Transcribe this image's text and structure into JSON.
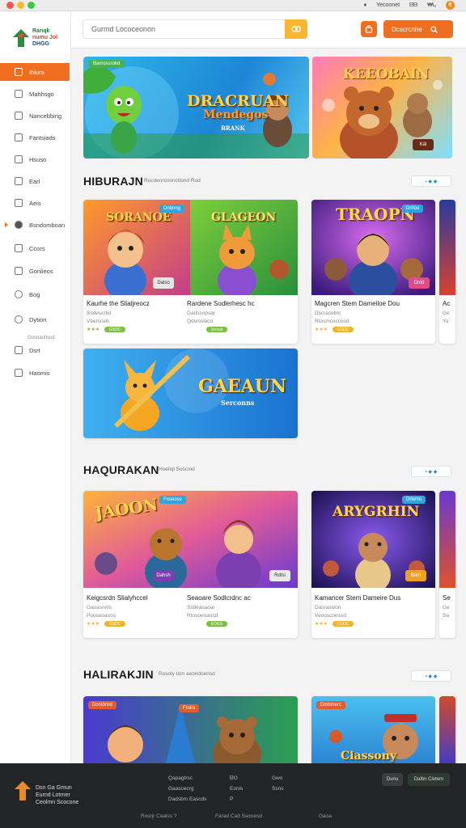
{
  "titlebar": {
    "items": [
      "Yecoonet",
      "ᗷᗷ",
      "₩iₒ"
    ],
    "badge": "₴"
  },
  "header": {
    "search_placeholder": "Gurmd Lococeonon",
    "login_label": "Dcscrcnhe"
  },
  "sidebar": {
    "logo": {
      "line1": "Ranqk",
      "line2": "numu Jol",
      "line3": "DHGG"
    },
    "items": [
      {
        "label": "Ihiura",
        "icon": "home-icon",
        "active": true
      },
      {
        "label": "Mahhsgo",
        "icon": "star-icon"
      },
      {
        "label": "Nancebbing",
        "icon": "gift-icon"
      },
      {
        "label": "Fantsiads",
        "icon": "grid-icon"
      },
      {
        "label": "Hsuso",
        "icon": "house-icon"
      },
      {
        "label": "Earl",
        "icon": "card-icon"
      },
      {
        "label": "Aeis",
        "icon": "tag-icon"
      },
      {
        "label": "Bsndomboan",
        "icon": "user-icon"
      },
      {
        "label": "Ccors",
        "icon": "coin-icon"
      },
      {
        "label": "Gonlieos",
        "icon": "chart-icon"
      },
      {
        "label": "Bog",
        "icon": "search-icon"
      },
      {
        "label": "Dytion",
        "icon": "gear-icon"
      },
      {
        "label": "Dsrt",
        "icon": "calendar-icon"
      },
      {
        "label": "Haomis",
        "icon": "book-icon"
      }
    ],
    "sub_label": "Gosoaotivud"
  },
  "banners": [
    {
      "tag": "Bamossrokd",
      "title_line1": "DRACRUAN",
      "title_line2": "Mendegos",
      "title_line3": "BRANK"
    },
    {
      "title": "KEEOBAIN",
      "button": "Kǎl"
    }
  ],
  "sections": [
    {
      "title": "HIBURAJN",
      "subtitle": "Rucdenrcoonctiond Rod",
      "button": "▪  ◆  ◆",
      "cards": [
        {
          "title": "Kaurhe the Slialjreocz",
          "meta1": "Ssdescrtid",
          "meta2": "Vbersceb.",
          "image_title": "SORANOE",
          "chip": "Dnbnng",
          "btn": "Dalso",
          "stars": "★★★",
          "pill": "GSDC"
        },
        {
          "title": "Rardene Sodlerhesc hc",
          "meta1": "Gadssopsar",
          "meta2": "Qoolsslaco",
          "image_title": "GLAGEON",
          "chip": "",
          "btn": "",
          "stars": "",
          "pill": "1rlosal"
        },
        {
          "title": "Magcren Stem Dameiloe Dou",
          "meta1": "Dscraseblc",
          "meta2": "Rtosmcoccesd",
          "image_title": "TRAOPN",
          "chip": "Drrloo",
          "btn": "Dnld",
          "stars": "★★★",
          "pill": "CGDC"
        },
        {
          "title": "Ac",
          "meta1": "Ge",
          "meta2": "Yo"
        },
        {
          "image_title": "GAEAUN",
          "image_sub": "Serconns"
        }
      ]
    },
    {
      "title": "HAQURAKAN",
      "subtitle": "Hoeliql Soscind",
      "button": "▪  ◆  ◆",
      "cards": [
        {
          "title": "Keigcsrdn Slialyhccel",
          "meta1": "Gaoasnnls",
          "meta2": "Pooseoaoos",
          "image_title": "JAOON",
          "chip": "Foseoss",
          "btn": "Dahsh",
          "stars": "★★★",
          "pill": "GSDC"
        },
        {
          "title": "Seaoare Sodlcrdnc ac",
          "meta1": "Ssdeasaoar",
          "meta2": "Rtosoeoaocd",
          "image_title": "",
          "chip": "",
          "btn": "Rdtsi",
          "stars": "",
          "pill": "EDGS"
        },
        {
          "title": "Kamancer Stem Dameire Dus",
          "meta1": "Dasrassion",
          "meta2": "Veooscoesod",
          "image_title": "ARYGRHIN",
          "chip": "Drlemo",
          "btn": "Bant",
          "stars": "★★★",
          "pill": "CGDC"
        },
        {
          "title": "Se",
          "meta1": "Ge",
          "meta2": "Sa"
        }
      ]
    },
    {
      "title": "HALIRAKJIN",
      "subtitle": "Rosoly tion aeondoensd",
      "button": "▪  ◆  ◆",
      "cards": [
        {
          "chip": "Dontbrod",
          "chip2": "Frolrs"
        },
        {
          "chip": "Dmbmerc",
          "image_title": "Ciassony"
        }
      ]
    }
  ],
  "footer": {
    "brand_line1": "Dsn Ga Gmun",
    "brand_line2": "Eurnd Lotrner",
    "brand_line3": "Ceolmn Scocone",
    "col1": [
      "Qapagtrsc",
      "Gaascecrg",
      "Dadsbm Eascds"
    ],
    "col2": [
      "ᗷO",
      "Eonis",
      "P"
    ],
    "col3": [
      "Gwo",
      "Ssns",
      ""
    ],
    "btn1": "Dunu",
    "btn2": "Dalbn Clotem",
    "bottom": [
      "Rosrjr  Caaiss  ?",
      "Farad Cad Ssooesd",
      "Gaoa"
    ]
  },
  "colors": {
    "accent": "#ef6e1f",
    "yellow": "#f7b531",
    "footer": "#222426"
  }
}
